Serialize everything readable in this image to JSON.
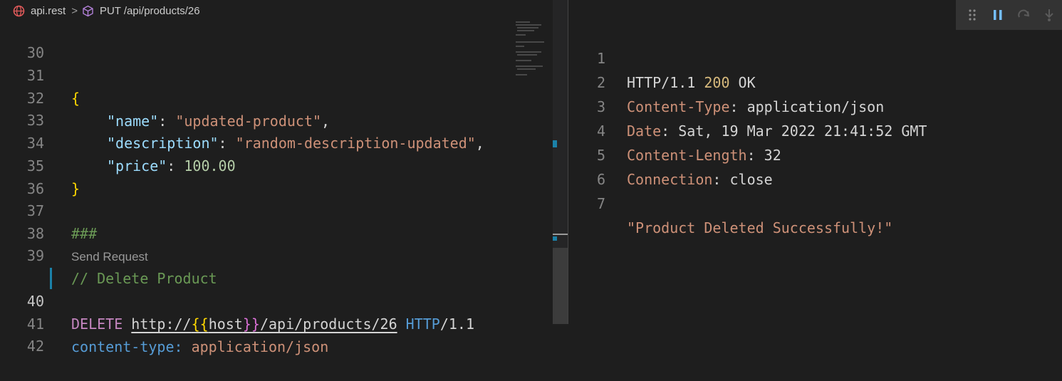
{
  "breadcrumb": {
    "file": "api.rest",
    "separator": ">",
    "symbol": "PUT /api/products/26"
  },
  "editor": {
    "codelens": "Send Request",
    "lines": [
      {
        "n": "30"
      },
      {
        "n": "31",
        "brace_open": "{"
      },
      {
        "n": "32",
        "key": "\"name\"",
        "colon": ": ",
        "value": "\"updated-product\"",
        "comma": ","
      },
      {
        "n": "33",
        "key": "\"description\"",
        "colon": ": ",
        "value": "\"random-description-updated\"",
        "comma": ","
      },
      {
        "n": "34",
        "key": "\"price\"",
        "colon": ": ",
        "value": "100.00"
      },
      {
        "n": "35",
        "brace_close": "}"
      },
      {
        "n": "36"
      },
      {
        "n": "37",
        "hash": "###"
      },
      {
        "n": "38"
      },
      {
        "n": "39",
        "comment": "// Delete Product"
      },
      {
        "n": "40",
        "method": "DELETE",
        "url_prefix": "http://",
        "tpl_open": "{{",
        "tpl_var": "host",
        "tpl_close": "}}",
        "url_path": "/api/products/26",
        "http": "HTTP",
        "version": "/1.1"
      },
      {
        "n": "41",
        "header": "content-type:",
        "header_value": " application/json"
      },
      {
        "n": "42"
      }
    ]
  },
  "response": {
    "lines": [
      {
        "n": "1",
        "proto": "HTTP/1.1 ",
        "status": "200",
        "status_text": " OK"
      },
      {
        "n": "2",
        "name": "Content-Type",
        "sep": ": ",
        "value": "application/json"
      },
      {
        "n": "3",
        "name": "Date",
        "sep": ": ",
        "value": "Sat, 19 Mar 2022 21:41:52 GMT"
      },
      {
        "n": "4",
        "name": "Content-Length",
        "sep": ": ",
        "value": "32"
      },
      {
        "n": "5",
        "name": "Connection",
        "sep": ": ",
        "value": "close"
      },
      {
        "n": "6"
      },
      {
        "n": "7",
        "body": "\"Product Deleted Successfully!\""
      }
    ]
  },
  "debug_toolbar": {
    "icons": [
      "drag-handle-icon",
      "pause-icon",
      "restart-icon",
      "step-into-icon"
    ]
  }
}
